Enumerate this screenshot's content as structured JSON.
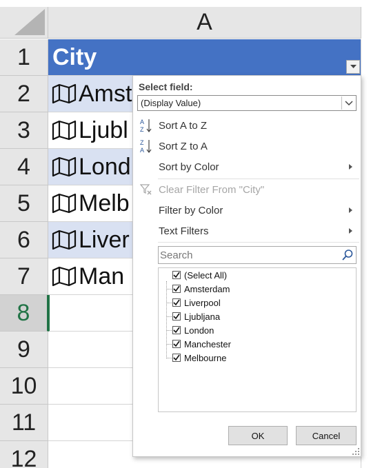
{
  "sheet": {
    "column_header": "A",
    "row_numbers": [
      "1",
      "2",
      "3",
      "4",
      "5",
      "6",
      "7",
      "8",
      "9",
      "10",
      "11",
      "12"
    ],
    "active_row": "8",
    "header_cell": "City",
    "cells": [
      "Amst",
      "Ljubl",
      "Lond",
      "Melb",
      "Liver",
      "Man"
    ],
    "cell_icon": "map-icon"
  },
  "filter_menu": {
    "select_field_label": "Select field:",
    "select_field_value": "(Display Value)",
    "sort_a_z": "Sort A to Z",
    "sort_z_a": "Sort Z to A",
    "sort_by_color": "Sort by Color",
    "clear_filter": "Clear Filter From \"City\"",
    "filter_by_color": "Filter by Color",
    "text_filters": "Text Filters",
    "search_placeholder": "Search",
    "items": [
      {
        "label": "(Select All)",
        "checked": true
      },
      {
        "label": "Amsterdam",
        "checked": true
      },
      {
        "label": "Liverpool",
        "checked": true
      },
      {
        "label": "Ljubljana",
        "checked": true
      },
      {
        "label": "London",
        "checked": true
      },
      {
        "label": "Manchester",
        "checked": true
      },
      {
        "label": "Melbourne",
        "checked": true
      }
    ],
    "ok_label": "OK",
    "cancel_label": "Cancel"
  },
  "colors": {
    "header_fill": "#4472c4",
    "band_fill": "#d9e1f2",
    "active_row_text": "#217346"
  }
}
